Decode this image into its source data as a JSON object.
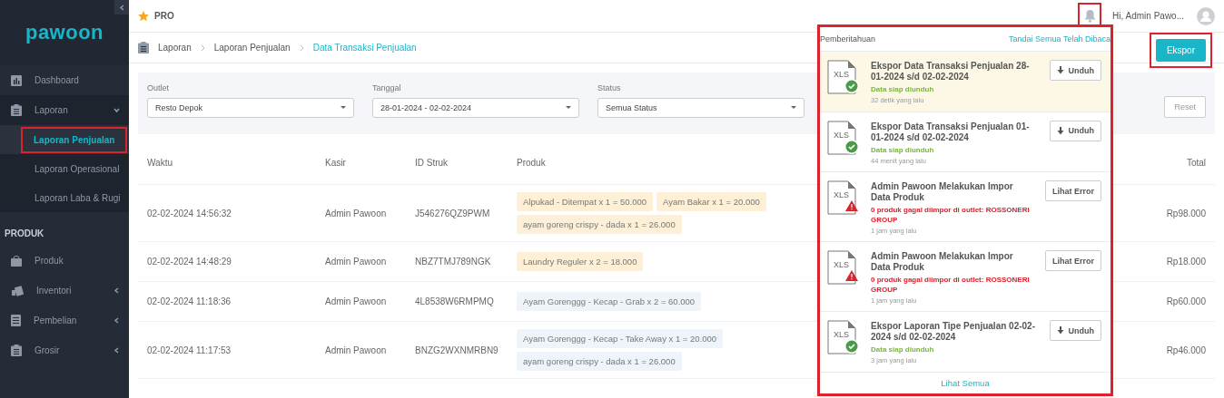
{
  "sidebar": {
    "logo": "pawoon",
    "items": [
      {
        "label": "Dashboard",
        "has_caret": false
      },
      {
        "label": "Laporan",
        "expanded": true,
        "has_caret": true,
        "children": [
          {
            "label": "Laporan Penjualan",
            "selected": true,
            "highlighted": true
          },
          {
            "label": "Laporan Operasional",
            "selected": false,
            "highlighted": false
          },
          {
            "label": "Laporan Laba & Rugi",
            "selected": false,
            "highlighted": false
          }
        ]
      }
    ],
    "section": "PRODUK",
    "section_items": [
      {
        "label": "Produk",
        "has_caret": false
      },
      {
        "label": "Inventori",
        "has_caret": true
      },
      {
        "label": "Pembelian",
        "has_caret": true
      },
      {
        "label": "Grosir",
        "has_caret": true
      }
    ]
  },
  "topbar": {
    "plan": "PRO",
    "user": "Hi, Admin Pawo...",
    "bell_highlighted": true
  },
  "breadcrumb": [
    "Laporan",
    "Laporan Penjualan",
    "Data Transaksi Penjualan"
  ],
  "export_button": {
    "label": "Ekspor",
    "highlighted": true
  },
  "filters": [
    {
      "label": "Outlet",
      "value": "Resto Depok"
    },
    {
      "label": "Tanggal",
      "value": "28-01-2024 - 02-02-2024"
    },
    {
      "label": "Status",
      "value": "Semua Status"
    }
  ],
  "reset_button": "Reset",
  "table": {
    "columns": [
      "Waktu",
      "Kasir",
      "ID Struk",
      "Produk",
      "Total"
    ],
    "rows": [
      {
        "time": "02-02-2024 14:56:32",
        "cashier": "Admin Pawoon",
        "id": "J546276QZ9PWM",
        "total": "Rp98.000",
        "products": [
          {
            "text": "Alpukad - Ditempat x 1 = 50.000",
            "color": "#fdf0d6"
          },
          {
            "text": "Ayam Bakar x 1 = 20.000",
            "color": "#fdf0d6"
          },
          {
            "text": "ayam goreng crispy - dada x 1 = 26.000",
            "color": "#fdf0d6"
          }
        ]
      },
      {
        "time": "02-02-2024 14:48:29",
        "cashier": "Admin Pawoon",
        "id": "NBZ7TMJ789NGK",
        "total": "Rp18.000",
        "products": [
          {
            "text": "Laundry Reguler x 2 = 18.000",
            "color": "#fdf0d6"
          }
        ]
      },
      {
        "time": "02-02-2024 11:18:36",
        "cashier": "Admin Pawoon",
        "id": "4L8538W6RMPMQ",
        "total": "Rp60.000",
        "products": [
          {
            "text": "Ayam Gorenggg - Kecap - Grab x 2 = 60.000",
            "color": "#eef4fa"
          }
        ]
      },
      {
        "time": "02-02-2024 11:17:53",
        "cashier": "Admin Pawoon",
        "id": "BNZG2WXNMRBN9",
        "total": "Rp46.000",
        "products": [
          {
            "text": "Ayam Gorenggg - Kecap - Take Away x 1 = 20.000",
            "color": "#eef4fa"
          },
          {
            "text": "ayam goreng crispy - dada x 1 = 26.000",
            "color": "#eef4fa"
          }
        ]
      }
    ]
  },
  "notifications": {
    "title": "Pemberitahuan",
    "mark_all": "Tandai Semua Telah Dibaca",
    "highlighted": true,
    "footer": "Lihat Semua",
    "items": [
      {
        "kind": "success",
        "unread": true,
        "file_type": "XLS",
        "title": "Ekspor Data Transaksi Penjualan 28-01-2024 s/d 02-02-2024",
        "status": "Data siap diunduh",
        "time": "32 detik yang lalu",
        "action": "Unduh"
      },
      {
        "kind": "success",
        "unread": false,
        "file_type": "XLS",
        "title": "Ekspor Data Transaksi Penjualan 01-01-2024 s/d 02-02-2024",
        "status": "Data siap diunduh",
        "time": "44 menit yang lalu",
        "action": "Unduh"
      },
      {
        "kind": "error",
        "unread": false,
        "file_type": "XLS",
        "title": "Admin Pawoon Melakukan Impor Data Produk",
        "status": "0 produk gagal diimpor di outlet: ROSSONERI GROUP",
        "time": "1 jam yang lalu",
        "action": "Lihat Error"
      },
      {
        "kind": "error",
        "unread": false,
        "file_type": "XLS",
        "title": "Admin Pawoon Melakukan Impor Data Produk",
        "status": "0 produk gagal diimpor di outlet: ROSSONERI GROUP",
        "time": "1 jam yang lalu",
        "action": "Lihat Error"
      },
      {
        "kind": "success",
        "unread": false,
        "file_type": "XLS",
        "title": "Ekspor Laporan Tipe Penjualan 02-02-2024 s/d 02-02-2024",
        "status": "Data siap diunduh",
        "time": "3 jam yang lalu",
        "action": "Unduh"
      }
    ]
  }
}
